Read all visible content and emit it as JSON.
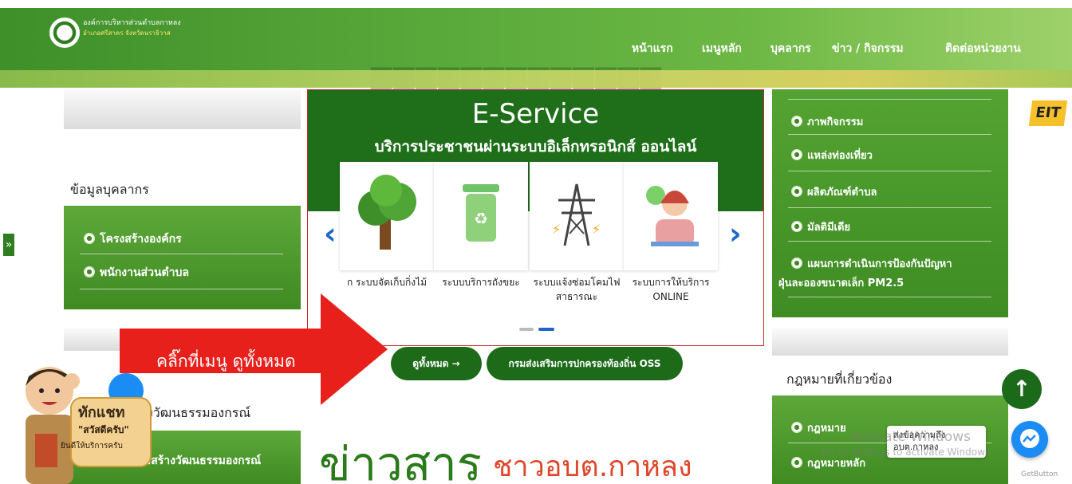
{
  "header": {
    "org_name": "องค์การบริหารส่วนตำบลกาหลง",
    "org_sub": "อำเภอศรีสาคร จังหวัดนราธิวาส",
    "nav": [
      "หน้าแรก",
      "เมนูหลัก",
      "บุคลากร",
      "ข่าว / กิจกรรม",
      "ติดต่อหน่วยงาน"
    ]
  },
  "left": {
    "personnel_title": "ข้อมูลบุคลากร",
    "personnel_items": [
      "โครงสร้างองค์กร",
      "พนักงานส่วนตำบล"
    ],
    "culture_title": "างวัฒนธรรมองกรณ์",
    "culture_item": "มสร้างวัฒนธรรมองกรณ์"
  },
  "eservice": {
    "title": "E-Service",
    "subtitle": "บริการประชาชนผ่านระบบอิเล็กทรอนิกส์ ออนไลน์",
    "cards": [
      {
        "label": "ก ระบบจัดเก็บกิ่งไม้",
        "icon": "tree-icon"
      },
      {
        "label": "ระบบบริการถังขยะ",
        "icon": "recycle-bin-icon"
      },
      {
        "label": "ระบบแจ้งซ่อมโคมไฟสาธารณะ",
        "icon": "power-tower-icon"
      },
      {
        "label": "ระบบการให้บริการ ONLINE",
        "icon": "call-center-icon"
      }
    ],
    "prev": "‹",
    "next": "›"
  },
  "buttons": {
    "view_all": "ดูทั้งหมด →",
    "oss": "กรมส่งเสริมการปกครองท้องถิ่น OSS"
  },
  "annotation": {
    "arrow_text": "คลิ๊กที่เมนู ดูทั้งหมด"
  },
  "right": {
    "items": [
      "ภาพกิจกรรม",
      "แหล่งท่องเที่ยว",
      "ผลิตภัณฑ์ตำบล",
      "มัลติมีเดีย"
    ],
    "pm_item_line1": "แผนการดำเนินการป้องกันปัญหา",
    "pm_item_line2": "ฝุ่นละอองขนาดเล็ก PM2.5",
    "law_title": "กฎหมายที่เกี่ยวข้อง",
    "law_items": [
      "กฎหมาย",
      "กฎหมายหลัก"
    ]
  },
  "news": {
    "title": "ข่าวสาร",
    "subtitle": "ชาวอบต.กาหลง"
  },
  "mascot": {
    "line1": "ทักแชท",
    "line2": "\"สวัสดีครับ\"",
    "line3": "ยินดีให้บริการครับ"
  },
  "chat": {
    "tooltip_line1": "ส่งข้อความถึง",
    "tooltip_line2": "อบต.กาหลง",
    "watermark_line1": "Activate Windows",
    "watermark_line2": "Go to Settings to activate Windows.",
    "getbutton": "GetButton"
  },
  "side_tab": "»",
  "eit": "EIT",
  "colors": {
    "brand_green": "#1f6e1a",
    "header_green": "#58a83a",
    "annotation_red": "#e8201c",
    "accent_blue": "#1f66c8"
  }
}
